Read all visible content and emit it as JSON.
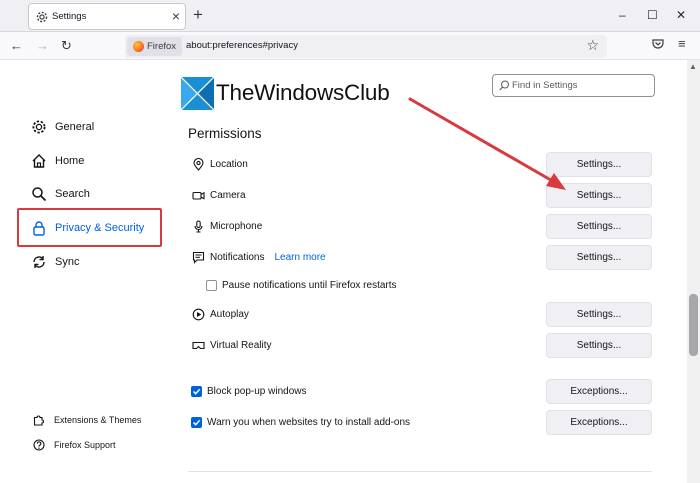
{
  "window": {
    "tab_title": "Settings",
    "tab_icon": "gear-icon",
    "controls": {
      "minimize": "–",
      "maximize": "☐",
      "close": "✕"
    }
  },
  "navbar": {
    "identity_label": "Firefox",
    "url": "about:preferences#privacy"
  },
  "sidebar": {
    "items": [
      {
        "label": "General",
        "icon": "gear-icon"
      },
      {
        "label": "Home",
        "icon": "home-icon"
      },
      {
        "label": "Search",
        "icon": "search-icon"
      },
      {
        "label": "Privacy & Security",
        "icon": "lock-icon"
      },
      {
        "label": "Sync",
        "icon": "sync-icon"
      }
    ],
    "bottom": [
      {
        "label": "Extensions & Themes",
        "icon": "puzzle-icon"
      },
      {
        "label": "Firefox Support",
        "icon": "help-icon"
      }
    ]
  },
  "logo": {
    "text": "TheWindowsClub"
  },
  "search": {
    "placeholder": "Find in Settings"
  },
  "permissions": {
    "heading": "Permissions",
    "rows": [
      {
        "label": "Location",
        "icon": "location-icon",
        "button": "Settings..."
      },
      {
        "label": "Camera",
        "icon": "camera-icon",
        "button": "Settings..."
      },
      {
        "label": "Microphone",
        "icon": "microphone-icon",
        "button": "Settings..."
      },
      {
        "label": "Notifications",
        "icon": "notification-icon",
        "button": "Settings...",
        "link": "Learn more"
      },
      {
        "label": "Autoplay",
        "icon": "autoplay-icon",
        "button": "Settings..."
      },
      {
        "label": "Virtual Reality",
        "icon": "vr-headset-icon",
        "button": "Settings..."
      }
    ],
    "pause_notifications": {
      "label": "Pause notifications until Firefox restarts",
      "checked": false
    },
    "block_popups": {
      "label": "Block pop-up windows",
      "checked": true,
      "button": "Exceptions..."
    },
    "warn_addons": {
      "label": "Warn you when websites try to install add-ons",
      "checked": true,
      "button": "Exceptions..."
    }
  },
  "colors": {
    "accent": "#0061e0",
    "annotation": "#d93a3d",
    "logo_blue": "#1a8fd6"
  }
}
